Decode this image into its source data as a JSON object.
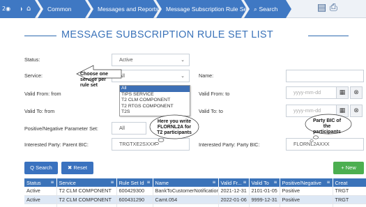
{
  "nav": {
    "start_label": "2",
    "home_icon": "home-icon",
    "breadcrumbs": [
      "Common",
      "Messages and Reports",
      "Message Subscription Rule Sets",
      "Search"
    ],
    "search_icon": "search-icon",
    "toolbar_icons": [
      "clipboard-icon",
      "printer-icon"
    ]
  },
  "page": {
    "title": "MESSAGE SUBSCRIPTION RULE SET LIST"
  },
  "form": {
    "status": {
      "label": "Status:",
      "value": "Active"
    },
    "service": {
      "label": "Service:",
      "value": "All"
    },
    "name": {
      "label": "Name:",
      "value": ""
    },
    "valid_from_from": {
      "label": "Valid From: from",
      "placeholder": "yyyy-mm-dd"
    },
    "valid_from_to": {
      "label": "Valid From: to",
      "placeholder": "yyyy-mm-dd"
    },
    "valid_to_from": {
      "label": "Valid To: from",
      "placeholder": "yyyy-mm-dd"
    },
    "valid_to_to": {
      "label": "Valid To: to",
      "placeholder": "yyyy-mm-dd"
    },
    "pos_neg": {
      "label": "Positive/Negative Parameter Set:",
      "value": "All"
    },
    "parent_bic": {
      "label": "Interested Party: Parent BIC:",
      "value": "TRGTXE2SXXX"
    },
    "party_bic": {
      "label": "Interested Party: Party BIC:",
      "value": "FLORNL2AXXX"
    }
  },
  "service_dropdown": {
    "options": [
      "All",
      "TIPS SERVICE",
      "T2 CLM COMPONENT",
      "T2 RTGS COMPONENT",
      "T2S"
    ],
    "selected": "All"
  },
  "callouts": {
    "service": "Choose one service per rule set",
    "florn": "Here you write FLORNL2A for T2 participants",
    "party_bic": "Party BIC of the participants"
  },
  "buttons": {
    "search": "Q Search",
    "reset": "✖ Reset",
    "new": "+ New"
  },
  "table": {
    "columns": [
      "Status",
      "Service",
      "Rule Set Id",
      "Name",
      "Valid Fr...",
      "Valid To",
      "Positive/Negative",
      "Creat"
    ],
    "rows": [
      [
        "Active",
        "T2 CLM COMPONENT",
        "600429300",
        "BankToCustomerNotification",
        "2021-12-31",
        "2101-01-05",
        "Positive",
        "TRGT"
      ],
      [
        "Active",
        "T2 CLM COMPONENT",
        "600431290",
        "Camt.054",
        "2022-01-06",
        "9999-12-31",
        "Positive",
        "TRGT"
      ]
    ]
  },
  "colors": {
    "accent": "#3b73b9",
    "new_button": "#4caf50",
    "selected_row": "#dde8f5"
  }
}
